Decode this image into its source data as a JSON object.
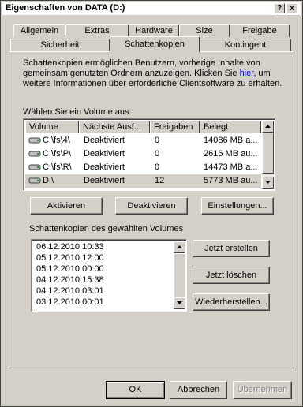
{
  "window": {
    "title": "Eigenschaften von DATA (D:)",
    "help_button": "?",
    "close_button": "x"
  },
  "tabs": {
    "row1": [
      "Allgemein",
      "Extras",
      "Hardware",
      "Size",
      "Freigabe"
    ],
    "row2": [
      "Sicherheit",
      "Schattenkopien",
      "Kontingent"
    ],
    "active": "Schattenkopien"
  },
  "description": {
    "line1": "Schattenkopien ermöglichen Benutzern, vorherige Inhalte von",
    "line2": "gemeinsam genutzten Ordnern anzuzeigen. Klicken Sie ",
    "link": "hier",
    "line2_end": ", um",
    "line3": "weitere Informationen über erforderliche Clientsoftware zu erhalten."
  },
  "volume_list": {
    "label": "Wählen Sie ein Volume aus:",
    "columns": [
      "Volume",
      "Nächste Ausf...",
      "Freigaben",
      "Belegt"
    ],
    "rows": [
      {
        "volume": "C:\\fs\\4\\",
        "next": "Deaktiviert",
        "shares": "0",
        "used": "14086 MB a..."
      },
      {
        "volume": "C:\\fs\\P\\",
        "next": "Deaktiviert",
        "shares": "0",
        "used": "2616 MB au..."
      },
      {
        "volume": "C:\\fs\\R\\",
        "next": "Deaktiviert",
        "shares": "0",
        "used": "14473 MB a..."
      },
      {
        "volume": "D:\\",
        "next": "Deaktiviert",
        "shares": "12",
        "used": "5773 MB au..."
      }
    ],
    "selected_row": 3
  },
  "volume_buttons": {
    "activate": "Aktivieren",
    "deactivate": "Deaktivieren",
    "settings": "Einstellungen..."
  },
  "snapshots": {
    "group_label": "Schattenkopien des gewählten Volumes",
    "items": [
      "06.12.2010 10:33",
      "05.12.2010 12:00",
      "05.12.2010 00:00",
      "04.12.2010 15:38",
      "04.12.2010 03:01",
      "03.12.2010 00:01"
    ],
    "create": "Jetzt erstellen",
    "delete": "Jetzt löschen",
    "restore": "Wiederherstellen..."
  },
  "dialog_buttons": {
    "ok": "OK",
    "cancel": "Abbrechen",
    "apply": "Übernehmen"
  },
  "colors": {
    "face": "#d4d0c8",
    "link": "#0000ff",
    "selection": "#d4d0c8"
  }
}
